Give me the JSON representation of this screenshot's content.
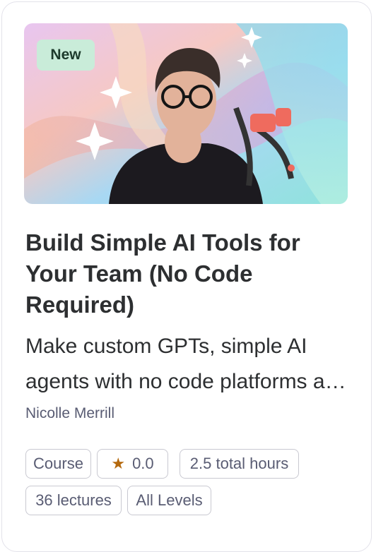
{
  "course": {
    "badge": "New",
    "title": "Build Simple AI Tools for Your Team (No Code Required)",
    "subtitle": "Make custom GPTs, simple AI agents with no code platforms and more",
    "instructor": "Nicolle Merrill",
    "tags": {
      "type": "Course",
      "rating": "0.0",
      "hours": "2.5 total hours",
      "lectures": "36 lectures",
      "level": "All Levels"
    }
  },
  "icons": {
    "rating": "star-icon"
  },
  "colors": {
    "badge_bg": "#c9ecd9",
    "star": "#b4690e",
    "text": "#2d2f31",
    "muted": "#595c73"
  }
}
